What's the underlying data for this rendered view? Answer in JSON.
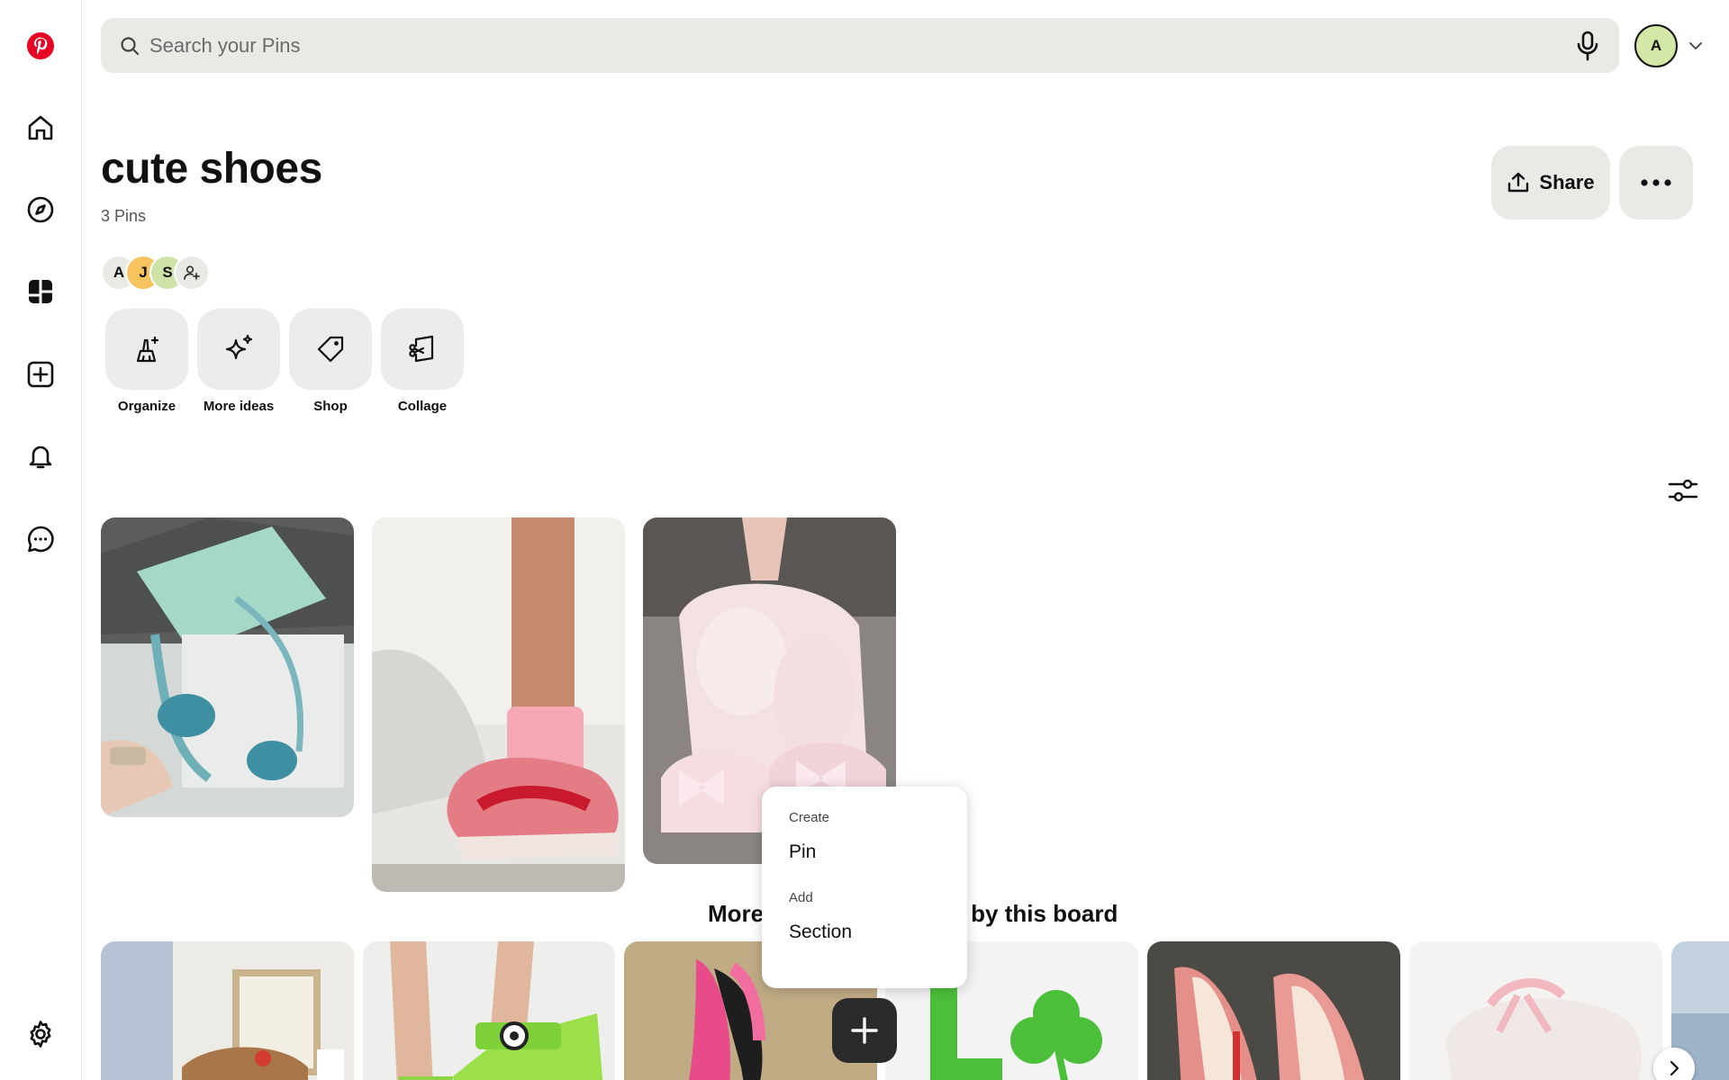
{
  "search": {
    "placeholder": "Search your Pins"
  },
  "user": {
    "initial": "A"
  },
  "board": {
    "title": "cute shoes",
    "pin_count": "3 Pins"
  },
  "header": {
    "share_label": "Share"
  },
  "collaborators": [
    "A",
    "J",
    "S"
  ],
  "actions": [
    {
      "label": "Organize",
      "icon": "broom-sparkle-icon"
    },
    {
      "label": "More ideas",
      "icon": "sparkle-icon"
    },
    {
      "label": "Shop",
      "icon": "tag-icon"
    },
    {
      "label": "Collage",
      "icon": "collage-scissors-icon"
    }
  ],
  "sidebar_icons": [
    "pinterest-logo-icon",
    "home-icon",
    "explore-icon",
    "boards-icon",
    "create-icon",
    "notifications-icon",
    "messages-icon",
    "settings-icon"
  ],
  "more_ideas": {
    "heading_left": "More",
    "heading_right": "by this board"
  },
  "menu": {
    "create_group": "Create",
    "create_item": "Pin",
    "add_group": "Add",
    "add_item": "Section"
  },
  "colors": {
    "brand": "#e60023",
    "avatar": "#d3e8a6",
    "surface": "#e9e9e6"
  }
}
